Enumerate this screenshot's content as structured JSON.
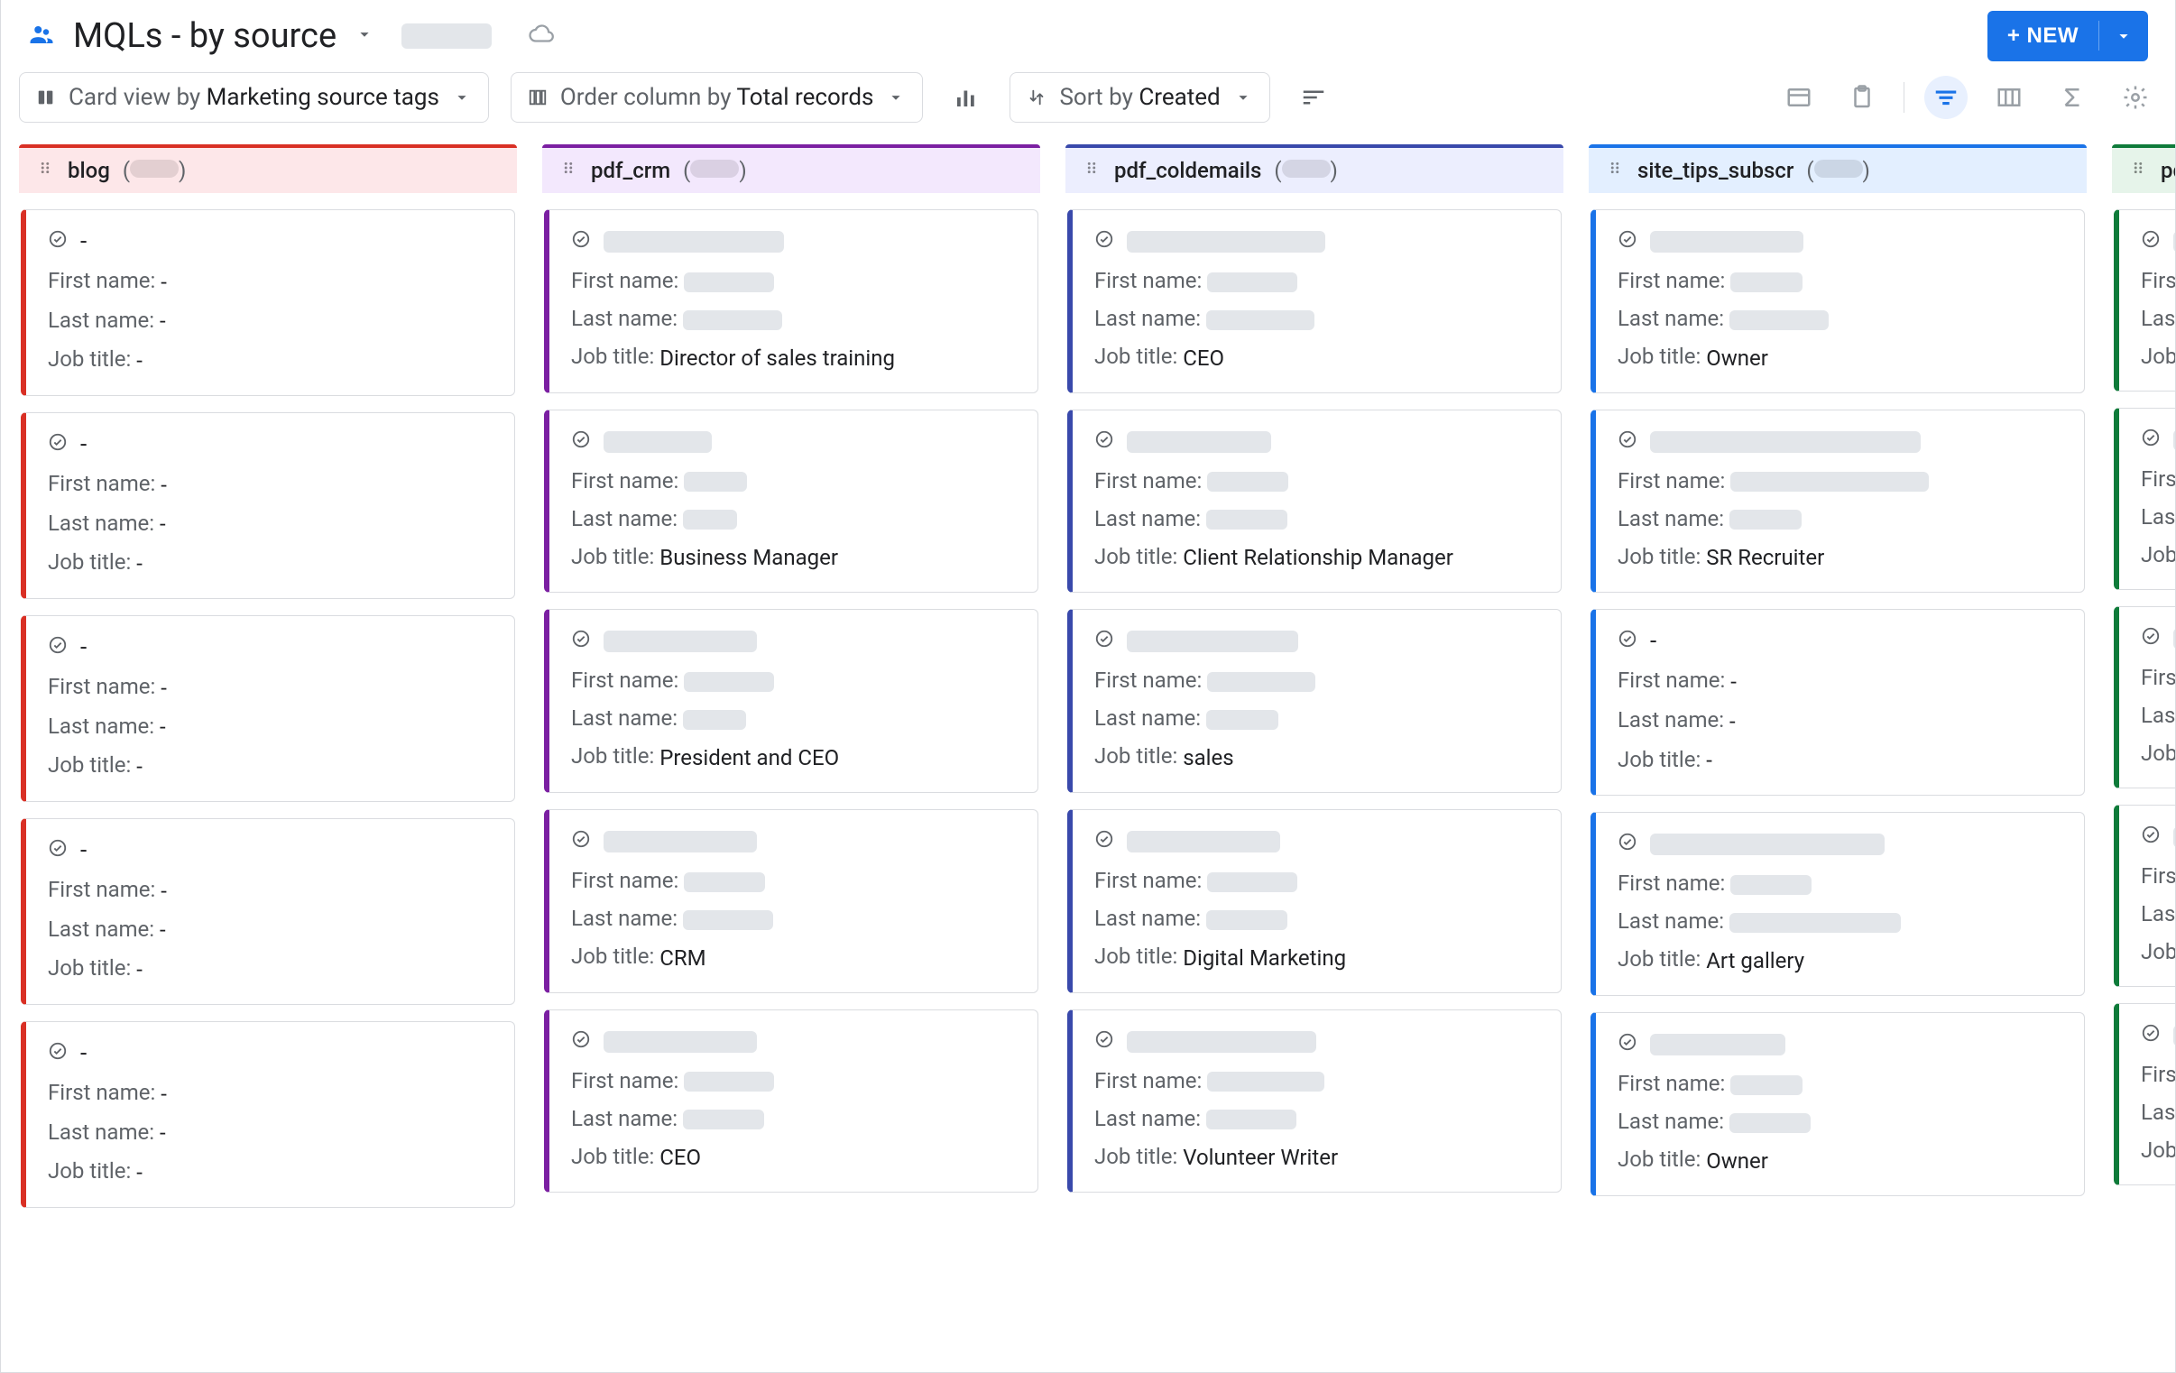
{
  "header": {
    "title": "MQLs - by source",
    "new_btn_label": "+ NEW"
  },
  "toolbar": {
    "card_view": {
      "prefix": "Card view by ",
      "value": "Marketing source tags"
    },
    "order": {
      "prefix": "Order column by ",
      "value": "Total records"
    },
    "sort": {
      "prefix": "Sort by ",
      "value": "Created"
    }
  },
  "field_labels": {
    "first_name": "First name: ",
    "last_name": "Last name: ",
    "job_title": "Job title: "
  },
  "columns": [
    {
      "key": "blog",
      "name": "blog",
      "color": "red",
      "count_redact_w": 54,
      "cards": [
        {
          "title": "-",
          "title_redact_w": 0,
          "first": "-",
          "last": "-",
          "job": "-"
        },
        {
          "title": "-",
          "title_redact_w": 0,
          "first": "-",
          "last": "-",
          "job": "-"
        },
        {
          "title": "-",
          "title_redact_w": 0,
          "first": "-",
          "last": "-",
          "job": "-"
        },
        {
          "title": "-",
          "title_redact_w": 0,
          "first": "-",
          "last": "-",
          "job": "-"
        },
        {
          "title": "-",
          "title_redact_w": 0,
          "first": "-",
          "last": "-",
          "job": "-"
        }
      ]
    },
    {
      "key": "pdf_crm",
      "name": "pdf_crm",
      "color": "purple",
      "count_redact_w": 54,
      "cards": [
        {
          "title_redact_w": 200,
          "first_redact_w": 100,
          "last_redact_w": 110,
          "job": "Director of sales training"
        },
        {
          "title_redact_w": 120,
          "first_redact_w": 70,
          "last_redact_w": 60,
          "job": "Business Manager"
        },
        {
          "title_redact_w": 170,
          "first_redact_w": 100,
          "last_redact_w": 70,
          "job": "President and CEO"
        },
        {
          "title_redact_w": 170,
          "first_redact_w": 90,
          "last_redact_w": 100,
          "job": "CRM"
        },
        {
          "title_redact_w": 170,
          "first_redact_w": 100,
          "last_redact_w": 90,
          "job": "CEO"
        }
      ]
    },
    {
      "key": "pdf_coldemails",
      "name": "pdf_coldemails",
      "color": "indigo",
      "count_redact_w": 54,
      "cards": [
        {
          "title_redact_w": 220,
          "first_redact_w": 100,
          "last_redact_w": 120,
          "job": "CEO"
        },
        {
          "title_redact_w": 160,
          "first_redact_w": 90,
          "last_redact_w": 90,
          "job": "Client Relationship Manager"
        },
        {
          "title_redact_w": 190,
          "first_redact_w": 120,
          "last_redact_w": 80,
          "job": "sales"
        },
        {
          "title_redact_w": 170,
          "first_redact_w": 100,
          "last_redact_w": 90,
          "job": "Digital Marketing"
        },
        {
          "title_redact_w": 210,
          "first_redact_w": 130,
          "last_redact_w": 100,
          "job": "Volunteer Writer"
        }
      ]
    },
    {
      "key": "site_tips",
      "name": "site_tips_subscr",
      "color": "sky",
      "count_redact_w": 54,
      "cards": [
        {
          "title_redact_w": 170,
          "first_redact_w": 80,
          "last_redact_w": 110,
          "job": "Owner"
        },
        {
          "title_redact_w": 300,
          "first_redact_w": 220,
          "last_redact_w": 80,
          "job": "SR Recruiter"
        },
        {
          "title": "-",
          "title_redact_w": 0,
          "first": "-",
          "last": "-",
          "job": "-"
        },
        {
          "title_redact_w": 260,
          "first_redact_w": 90,
          "last_redact_w": 190,
          "job": "Art gallery"
        },
        {
          "title_redact_w": 150,
          "first_redact_w": 80,
          "last_redact_w": 90,
          "job": "Owner"
        }
      ]
    },
    {
      "key": "pdf_au",
      "name": "pdf_au",
      "color": "green",
      "count_redact_w": 54,
      "cards": [
        {
          "title_redact_w": 50,
          "first_redact_w": 0,
          "last_redact_w": 0,
          "job": ""
        },
        {
          "title_redact_w": 60,
          "first_redact_w": 0,
          "last_redact_w": 0,
          "job": ""
        },
        {
          "title_redact_w": 70,
          "first_redact_w": 0,
          "last_redact_w": 0,
          "job": ""
        },
        {
          "title_redact_w": 60,
          "first_redact_w": 0,
          "last_redact_w": 0,
          "job": ""
        },
        {
          "title_redact_w": 50,
          "first_redact_w": 0,
          "last_redact_w": 0,
          "job": ""
        }
      ]
    }
  ]
}
